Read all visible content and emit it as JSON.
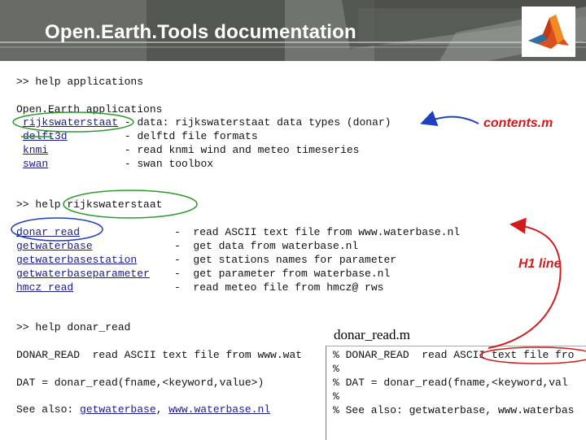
{
  "header": {
    "title": "Open.Earth.Tools documentation"
  },
  "logo": {
    "icon": "matlab-membrane-logo-icon"
  },
  "cmd1": {
    "prompt": ">> help applications",
    "heading": "Open.Earth applications",
    "rows": [
      {
        "name": "rijkswaterstaat",
        "sep": " - ",
        "desc": "data: rijkswaterstaat data types (donar)"
      },
      {
        "name": "delft3d",
        "sep": "         - ",
        "desc": "delftd file formats"
      },
      {
        "name": "knmi",
        "sep": "            - ",
        "desc": "read knmi wind and meteo timeseries"
      },
      {
        "name": "swan",
        "sep": "            - ",
        "desc": "swan toolbox"
      }
    ]
  },
  "cmd2": {
    "prompt_prefix": ">> help ",
    "prompt_arg": "rijkswaterstaat",
    "rows": [
      {
        "name": "donar_read",
        "desc": "-  read ASCII text file from www.waterbase.nl"
      },
      {
        "name": "getwaterbase",
        "desc": "-  get data from waterbase.nl"
      },
      {
        "name": "getwaterbasestation",
        "desc": "-  get stations names for parameter"
      },
      {
        "name": "getwaterbaseparameter",
        "desc": "-  get parameter from waterbase.nl"
      },
      {
        "name": "hmcz_read",
        "desc": "-  read meteo file from hmcz@ rws"
      }
    ]
  },
  "cmd3": {
    "prompt": ">> help donar_read",
    "line1_name": "DONAR_READ",
    "line1_rest": "  read ASCII text file from www.wat",
    "line2": "DAT = donar_read(fname,<keyword,value>)",
    "see_also_label": "See also: ",
    "see_also_link1": "getwaterbase",
    "see_also_sep": ", ",
    "see_also_link2": "www.waterbase.nl"
  },
  "annotations": {
    "contents": "contents.m",
    "h1": "H1 line",
    "file": "donar_read.m"
  },
  "file_panel": {
    "lines": [
      "% DONAR_READ  read ASCII text file fro",
      "%",
      "% DAT = donar_read(fname,<keyword,val",
      "%",
      "% See also: getwaterbase, www.waterbas"
    ]
  },
  "colors": {
    "annotation_blue": "#1e40c0",
    "annotation_red": "#d31b1b",
    "annotation_green": "#2e9a2e",
    "link": "#1a1a8c"
  }
}
